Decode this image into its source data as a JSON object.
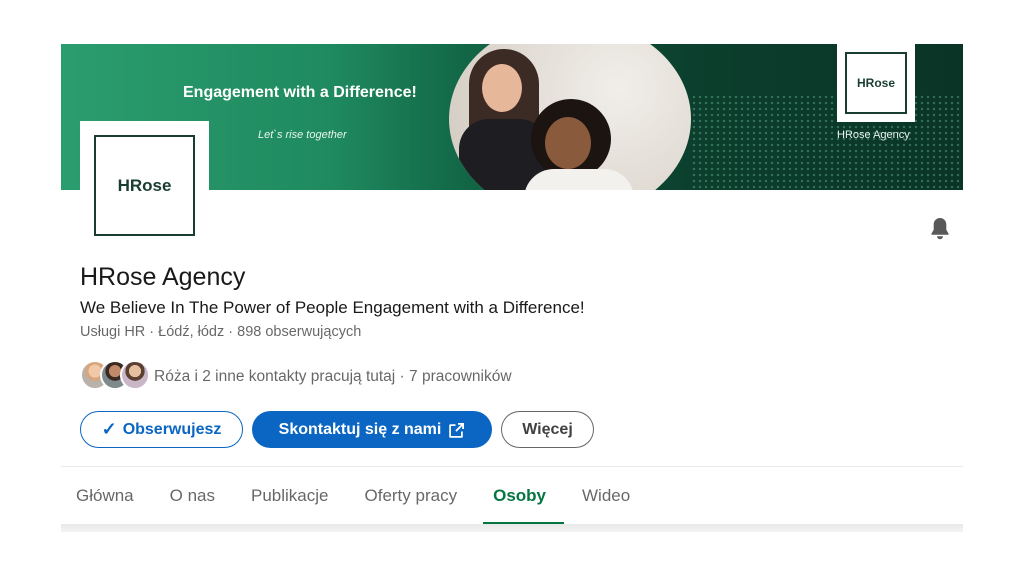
{
  "banner": {
    "tagline": "Engagement with a Difference!",
    "subtagline": "Let`s rise together",
    "logo_text": "HRose",
    "agency_label": "HRose Agency"
  },
  "profile": {
    "logo_text": "HRose",
    "name": "HRose Agency",
    "tagline": "We Believe In The Power of People Engagement with a Difference!",
    "meta": "Usługi HR · Łódź, łódz · 898 obserwujących"
  },
  "connections": {
    "text": "Róża i 2 inne kontakty pracują tutaj · 7 pracowników"
  },
  "actions": {
    "follow_label": "Obserwujesz",
    "contact_label": "Skontaktuj się z nami",
    "more_label": "Więcej"
  },
  "tabs": [
    {
      "label": "Główna"
    },
    {
      "label": "O nas"
    },
    {
      "label": "Publikacje"
    },
    {
      "label": "Oferty pracy"
    },
    {
      "label": "Osoby",
      "active": true
    },
    {
      "label": "Wideo"
    }
  ],
  "icons": {
    "bell": "bell-icon",
    "external_link": "external-link-icon",
    "check": "check-icon"
  },
  "colors": {
    "primary_blue": "#0a66c2",
    "active_tab_green": "#057642",
    "banner_green": "#1f8a5f",
    "banner_dark": "#0a3426"
  }
}
